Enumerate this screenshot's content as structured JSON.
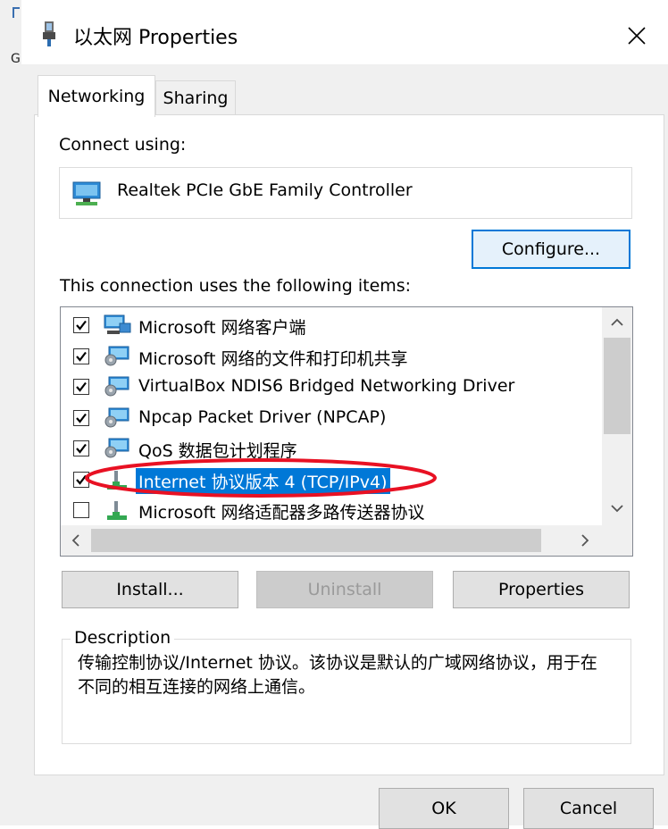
{
  "dialog": {
    "title": "以太网 Properties",
    "close_glyph": "✕"
  },
  "tabs": [
    {
      "label": "Networking",
      "active": true
    },
    {
      "label": "Sharing",
      "active": false
    }
  ],
  "networking": {
    "connect_using_label": "Connect using:",
    "adapter_name": "Realtek PCIe GbE Family Controller",
    "configure_label": "Configure...",
    "items_label": "This connection uses the following items:",
    "items": [
      {
        "label": "Microsoft 网络客户端",
        "checked": true,
        "icon": "network-client-icon"
      },
      {
        "label": "Microsoft 网络的文件和打印机共享",
        "checked": true,
        "icon": "network-service-icon"
      },
      {
        "label": "VirtualBox NDIS6 Bridged Networking Driver",
        "checked": true,
        "icon": "network-service-icon"
      },
      {
        "label": "Npcap Packet Driver (NPCAP)",
        "checked": true,
        "icon": "network-service-icon"
      },
      {
        "label": "QoS 数据包计划程序",
        "checked": true,
        "icon": "network-service-icon"
      },
      {
        "label": "Internet 协议版本 4 (TCP/IPv4)",
        "checked": true,
        "selected": true,
        "icon": "protocol-icon"
      },
      {
        "label": "Microsoft 网络适配器多路传送器协议",
        "checked": false,
        "icon": "protocol-icon"
      }
    ],
    "install_label": "Install...",
    "uninstall_label": "Uninstall",
    "properties_label": "Properties",
    "description_legend": "Description",
    "description_text": "传输控制协议/Internet 协议。该协议是默认的广域网络协议，用于在不同的相互连接的网络上通信。"
  },
  "footer": {
    "ok_label": "OK",
    "cancel_label": "Cancel"
  },
  "background_window": {
    "glyph": "G"
  },
  "colors": {
    "accent": "#0078d7",
    "annotation": "#e81123",
    "dialog_bg": "#f0f0f0"
  }
}
